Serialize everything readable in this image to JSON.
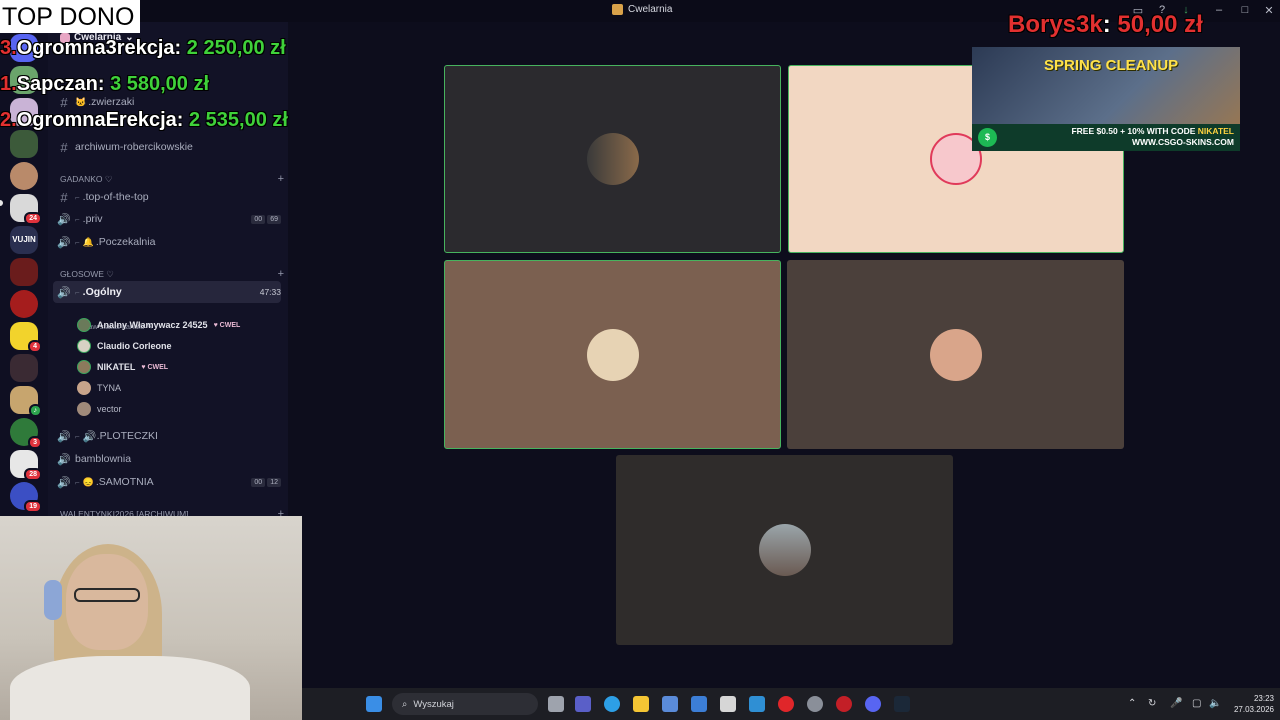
{
  "window": {
    "title": "Cwelarnia"
  },
  "overlay": {
    "top_dono_label": "TOP DONO",
    "donations": [
      {
        "rank": "3.",
        "name": "Ogromna3rekcja:",
        "amount": "2 250,00 zł"
      },
      {
        "rank": "1.",
        "name": "Sapczan:",
        "amount": "3 580,00 zł"
      },
      {
        "rank": "2.",
        "name": "OgromnaErekcja:",
        "amount": "2 535,00 zł"
      }
    ],
    "latest": {
      "name": "Borys3k",
      "sep": ":",
      "amount": "50,00 zł"
    }
  },
  "ad": {
    "headline": "SPRING CLEANUP",
    "promo_line1": "FREE $0.50 + 10% WITH CODE ",
    "promo_code": "NIKATEL",
    "promo_line2": "WWW.CSGO-SKINS.COM",
    "coin_icon": "$"
  },
  "sidebar": {
    "server_name": "Cwelarnia",
    "server_badges": [
      "24",
      "4",
      "3",
      "28",
      "19"
    ],
    "channels": [
      {
        "type": "text",
        "label": ".zwierzaki"
      },
      {
        "type": "text",
        "label": "archiwum-robercikowskie"
      }
    ],
    "category_gadanko": "GADANKO ♡",
    "gadanko_channels": [
      {
        "type": "text",
        "label": ".top-of-the-top"
      },
      {
        "type": "voice",
        "label": ".priv",
        "counts": [
          "00",
          "69"
        ]
      },
      {
        "type": "voice",
        "label": ".Poczekalnia"
      }
    ],
    "category_glosowe": "GŁOSOWE ♡",
    "active_channel": {
      "label": ".Ogólny",
      "timer": "47:33",
      "status": "Ustaw status kanału"
    },
    "voice_users": [
      {
        "name": "Analny Włamywacz 24525",
        "tag": "CWEL",
        "speaking": true
      },
      {
        "name": "Claudio Corleone",
        "tag": "",
        "speaking": true
      },
      {
        "name": "NIKATEL",
        "tag": "CWEL",
        "speaking": true
      },
      {
        "name": "TYNA",
        "tag": "",
        "speaking": false
      },
      {
        "name": "vector",
        "tag": "",
        "speaking": false
      }
    ],
    "more_channels": [
      {
        "type": "voice",
        "label": ".PLOTECZKI"
      },
      {
        "type": "voice",
        "label": "bamblownia"
      },
      {
        "type": "voice",
        "label": ".SAMOTNIA",
        "counts": [
          "00",
          "12"
        ]
      }
    ],
    "category_valentine": "WALENTYNKI2026 [ARCHIWUM]"
  },
  "taskbar": {
    "search_placeholder": "Wyszukaj",
    "time": "23:23",
    "date": "27.03.2026"
  },
  "colors": {
    "speaking_border": "#47b35e",
    "donation_green": "#3fd13a",
    "donation_red": "#e23030"
  }
}
